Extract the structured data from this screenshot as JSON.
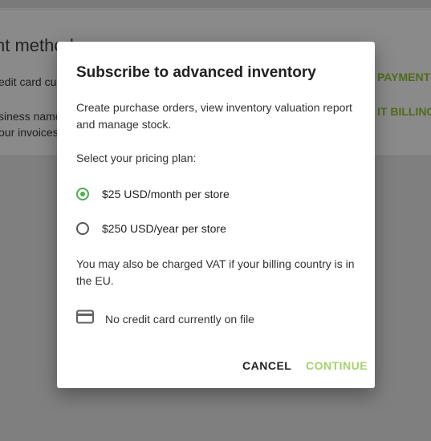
{
  "background": {
    "title": "nt method",
    "card_line": "edit card cur",
    "name_line1": "siness name",
    "name_line2": "our invoices",
    "payment_link": "PAYMENT",
    "billing_link": "IT BILLING"
  },
  "dialog": {
    "title": "Subscribe to advanced inventory",
    "description": "Create purchase orders, view inventory valuation report and manage stock.",
    "select_label": "Select your pricing plan:",
    "plans": [
      {
        "label": "$25 USD/month per store",
        "selected": true
      },
      {
        "label": "$250 USD/year per store",
        "selected": false
      }
    ],
    "vat_note": "You may also be charged VAT if your billing country is in the EU.",
    "card_status": "No credit card currently on file",
    "cancel_label": "CANCEL",
    "continue_label": "CONTINUE"
  },
  "colors": {
    "accent": "#4caf50",
    "continue_text": "#a4d36b",
    "overlay": "#7f7f7f"
  },
  "icons": {
    "card": "credit-card-icon"
  }
}
